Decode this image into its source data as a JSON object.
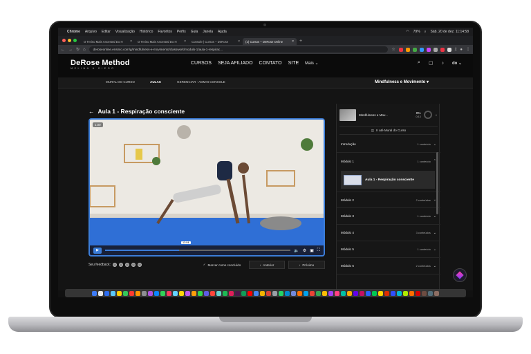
{
  "menubar": {
    "app": "Chrome",
    "menus": [
      "Arquivo",
      "Editar",
      "Visualização",
      "Histórico",
      "Favoritos",
      "Perfis",
      "Guia",
      "Janela",
      "Ajuda"
    ],
    "battery": "79%",
    "clock": "Sáb. 20 de dez. 11:14:58"
  },
  "browser": {
    "tabs": [
      {
        "title": "O Treino Mais Ancestral Do H",
        "active": false
      },
      {
        "title": "O Treino Mais Ancestral Do H",
        "active": false
      },
      {
        "title": "Console | Cursos – DeRose",
        "active": false
      },
      {
        "title": "(1) Cursos – DeRose Online",
        "active": true
      }
    ],
    "url": "deroseonline.ensinio.com/g/mindfulness-e-movimento/classwork/modulo-1/aula-1-respirac..."
  },
  "site": {
    "logo": "DeRose Method",
    "logo_sub": "MELINA & DIEGO",
    "nav": [
      "CURSOS",
      "SEJA AFILIADO",
      "CONTATO",
      "SITE",
      "Mais ⌄"
    ],
    "avatar_text": "do ⌄",
    "subnav": [
      "MURAL DO CURSO",
      "AULAS",
      "GERENCIAR - ADMIN CONSOLE"
    ],
    "course_select": "Mindfulness e Movimento"
  },
  "lesson": {
    "title": "Aula 1 - Respiração consciente",
    "speed": "1.00",
    "time": "13:04",
    "progress_fraction": 0.4,
    "feedback_label": "Seu feedback:",
    "mark_done": "Marcar como concluído",
    "prev": "Anterior",
    "next": "Próximo"
  },
  "sidebar": {
    "course_title": "Mindfulness e Mov...",
    "progress_pct": "0%",
    "progress_count": "0/13",
    "mural_button": "Ir até Mural do Curso",
    "modules": [
      {
        "name": "Introdução",
        "count": "1 conteúdo",
        "open": false
      },
      {
        "name": "Módulo 1",
        "count": "1 conteúdo",
        "open": true
      },
      {
        "name": "Módulo 2",
        "count": "2 conteúdos",
        "open": false
      },
      {
        "name": "Módulo 3",
        "count": "1 conteúdo",
        "open": false
      },
      {
        "name": "Módulo 4",
        "count": "3 conteúdos",
        "open": false
      },
      {
        "name": "Módulo 5",
        "count": "1 conteúdo",
        "open": false
      },
      {
        "name": "Módulo 6",
        "count": "2 conteúdos",
        "open": false
      }
    ],
    "active_lesson": "Aula 1 - Respiração consciente"
  },
  "colors": {
    "accent": "#3b7dd8",
    "dock": [
      "#3d7bf7",
      "#e8e8e8",
      "#2c6df0",
      "#5ac8fa",
      "#ffcc00",
      "#34c759",
      "#ff3b30",
      "#ff9500",
      "#8e8e93",
      "#af52de",
      "#0a84ff",
      "#30d158",
      "#ff375f",
      "#64d2ff",
      "#ffd60a",
      "#bf5af2",
      "#ff9f0a",
      "#32d74b",
      "#5e5ce6",
      "#ff453a",
      "#66d4cf",
      "#1db954",
      "#e01e5a",
      "#4a154b",
      "#0f9d58",
      "#ff0000",
      "#4285f4",
      "#f4b400",
      "#db4437",
      "#9aa0a6",
      "#25d366",
      "#0088cc",
      "#7289da",
      "#ff6f00",
      "#00a2ed",
      "#ea4335",
      "#34a853",
      "#fbbc05",
      "#a142f4",
      "#ff4081",
      "#00bfa5",
      "#ffab00",
      "#6200ea",
      "#c51162",
      "#2962ff",
      "#00c853",
      "#ffd600",
      "#dd2c00",
      "#304ffe",
      "#00b8d4",
      "#aeea00",
      "#ff6d00",
      "#d50000",
      "#6d4c41",
      "#546e7a",
      "#8d6e63"
    ]
  }
}
